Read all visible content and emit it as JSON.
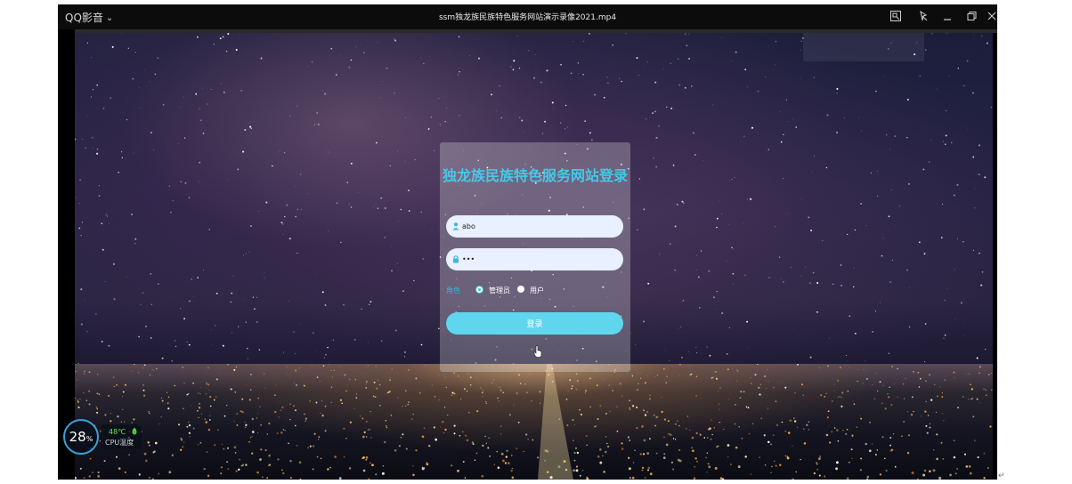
{
  "player": {
    "brand": "QQ影音",
    "video_title": "ssm独龙族民族特色服务网站演示录像2021.mp4",
    "icons": [
      "screenshot-icon",
      "pin-icon",
      "minimize-icon",
      "restore-icon",
      "close-icon"
    ]
  },
  "login": {
    "title": "独龙族民族特色服务网站登录",
    "username_value": "abo",
    "password_value": "•••",
    "role_label": "角色",
    "roles": [
      "管理员",
      "用户"
    ],
    "selected_role": "管理员",
    "submit_label": "登录",
    "accent_color": "#45c8e6",
    "button_color": "#5fd6ee"
  },
  "cpu_widget": {
    "percent": "28",
    "percent_unit": "%",
    "temperature": "48℃",
    "label": "CPU温度"
  },
  "page": {
    "enter_mark": "↵"
  }
}
